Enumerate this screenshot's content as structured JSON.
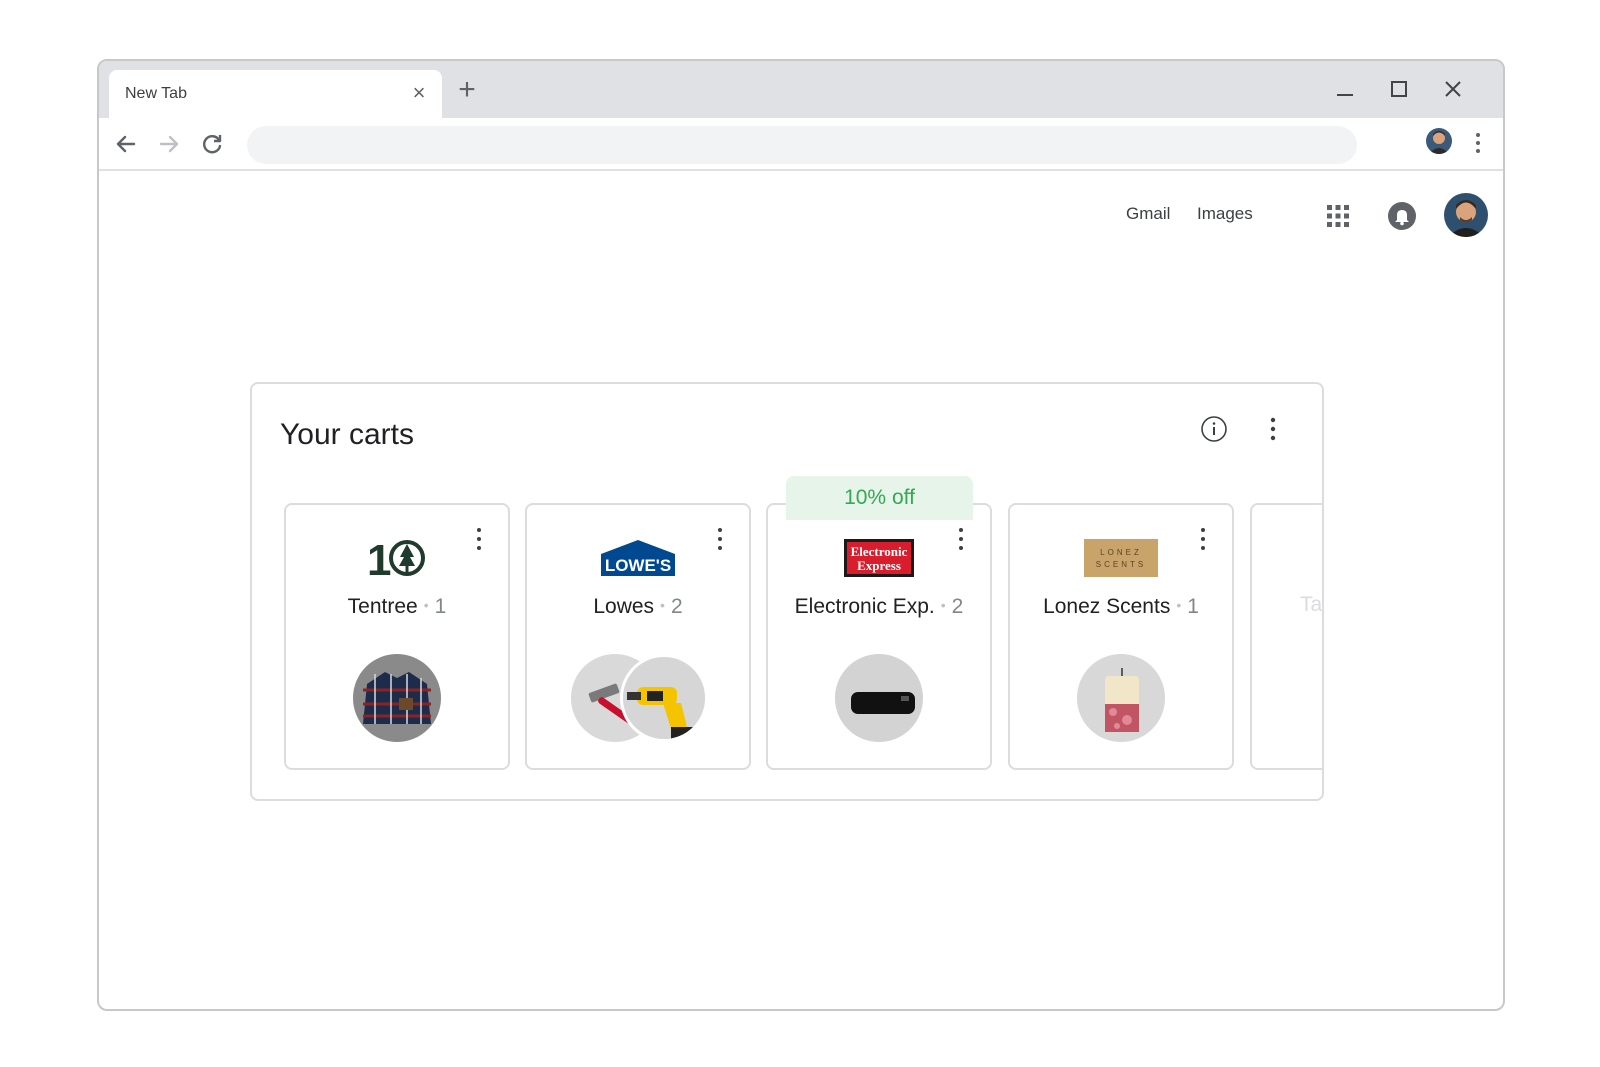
{
  "browser": {
    "tab": {
      "title": "New Tab",
      "close_icon": "close-icon"
    },
    "new_tab_icon": "plus-icon",
    "window_controls": [
      "minimize-icon",
      "maximize-icon",
      "close-icon"
    ],
    "nav": [
      "back-arrow-icon",
      "forward-arrow-icon",
      "reload-icon"
    ],
    "omnibox_value": ""
  },
  "header": {
    "gmail": "Gmail",
    "images": "Images",
    "apps_icon": "apps-grid-icon",
    "notifications_icon": "bell-icon"
  },
  "carts_module": {
    "title": "Your carts",
    "info_icon": "info-icon",
    "menu_icon": "more-vert-icon",
    "carts": [
      {
        "logo": "tentree-logo",
        "name": "Tentree",
        "count": "1",
        "items": [
          "flannel-shirt"
        ]
      },
      {
        "logo": "lowes-logo",
        "logo_text": "LOWE'S",
        "name": "Lowes",
        "count": "2",
        "items": [
          "hammer",
          "drill"
        ]
      },
      {
        "logo": "electronic-express-logo",
        "logo_text": [
          "Electronic",
          "Express"
        ],
        "name": "Electronic Exp.",
        "count": "2",
        "discount": "10% off",
        "items": [
          "soundbar"
        ]
      },
      {
        "logo": "lonez-scents-logo",
        "logo_text": [
          "LONEZ",
          "SCENTS"
        ],
        "name": "Lonez Scents",
        "count": "1",
        "items": [
          "candle"
        ]
      }
    ],
    "partial_cart_label": "Ta",
    "separator": "•"
  },
  "colors": {
    "accent_green": "#34a853",
    "discount_bg": "#e6f4ea",
    "border": "#dadce0"
  }
}
